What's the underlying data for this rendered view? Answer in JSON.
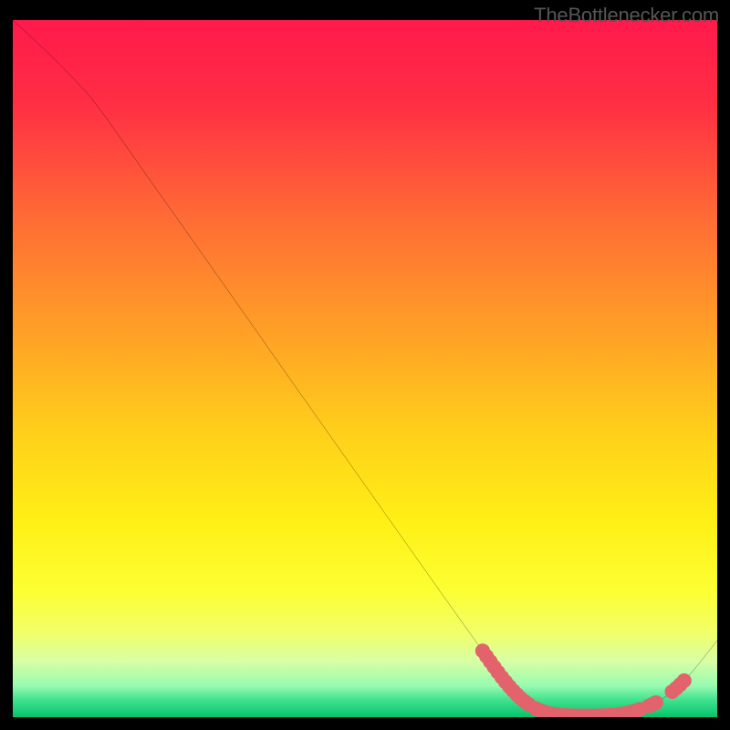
{
  "watermark": "TheBottlenecker.com",
  "chart_data": {
    "type": "line",
    "title": "",
    "xlabel": "",
    "ylabel": "",
    "xlim": [
      0,
      100
    ],
    "ylim": [
      0,
      100
    ],
    "background_gradient": {
      "stops": [
        {
          "offset": 0.0,
          "color": "#ff1a4b"
        },
        {
          "offset": 0.12,
          "color": "#ff2e44"
        },
        {
          "offset": 0.28,
          "color": "#ff6a35"
        },
        {
          "offset": 0.45,
          "color": "#ffa126"
        },
        {
          "offset": 0.6,
          "color": "#ffd21a"
        },
        {
          "offset": 0.72,
          "color": "#fff016"
        },
        {
          "offset": 0.82,
          "color": "#fcff33"
        },
        {
          "offset": 0.88,
          "color": "#f1ff6a"
        },
        {
          "offset": 0.92,
          "color": "#d7ffa5"
        },
        {
          "offset": 0.955,
          "color": "#97fbb0"
        },
        {
          "offset": 0.975,
          "color": "#41e28e"
        },
        {
          "offset": 1.0,
          "color": "#05c36b"
        }
      ]
    },
    "series": [
      {
        "name": "curve",
        "stroke": "#000000",
        "points": [
          {
            "x": 0.0,
            "y": 100.0
          },
          {
            "x": 5.0,
            "y": 95.3
          },
          {
            "x": 9.0,
            "y": 91.2
          },
          {
            "x": 12.5,
            "y": 87.0
          },
          {
            "x": 20.0,
            "y": 76.3
          },
          {
            "x": 30.0,
            "y": 62.0
          },
          {
            "x": 40.0,
            "y": 47.6
          },
          {
            "x": 50.0,
            "y": 33.3
          },
          {
            "x": 60.0,
            "y": 19.0
          },
          {
            "x": 66.0,
            "y": 10.5
          },
          {
            "x": 70.0,
            "y": 5.0
          },
          {
            "x": 73.0,
            "y": 2.0
          },
          {
            "x": 76.0,
            "y": 0.6
          },
          {
            "x": 80.0,
            "y": 0.2
          },
          {
            "x": 86.0,
            "y": 0.4
          },
          {
            "x": 90.0,
            "y": 1.5
          },
          {
            "x": 93.0,
            "y": 3.2
          },
          {
            "x": 96.0,
            "y": 6.0
          },
          {
            "x": 100.0,
            "y": 11.0
          }
        ]
      }
    ],
    "highlights": {
      "color": "#e2636b",
      "dot_radius": 1.05,
      "segments": [
        {
          "x_start": 66.7,
          "x_end": 73.2
        },
        {
          "x_start": 74.2,
          "x_end": 89.0
        },
        {
          "x_start": 90.3,
          "x_end": 91.3
        },
        {
          "x_start": 93.6,
          "x_end": 95.3
        }
      ]
    }
  }
}
